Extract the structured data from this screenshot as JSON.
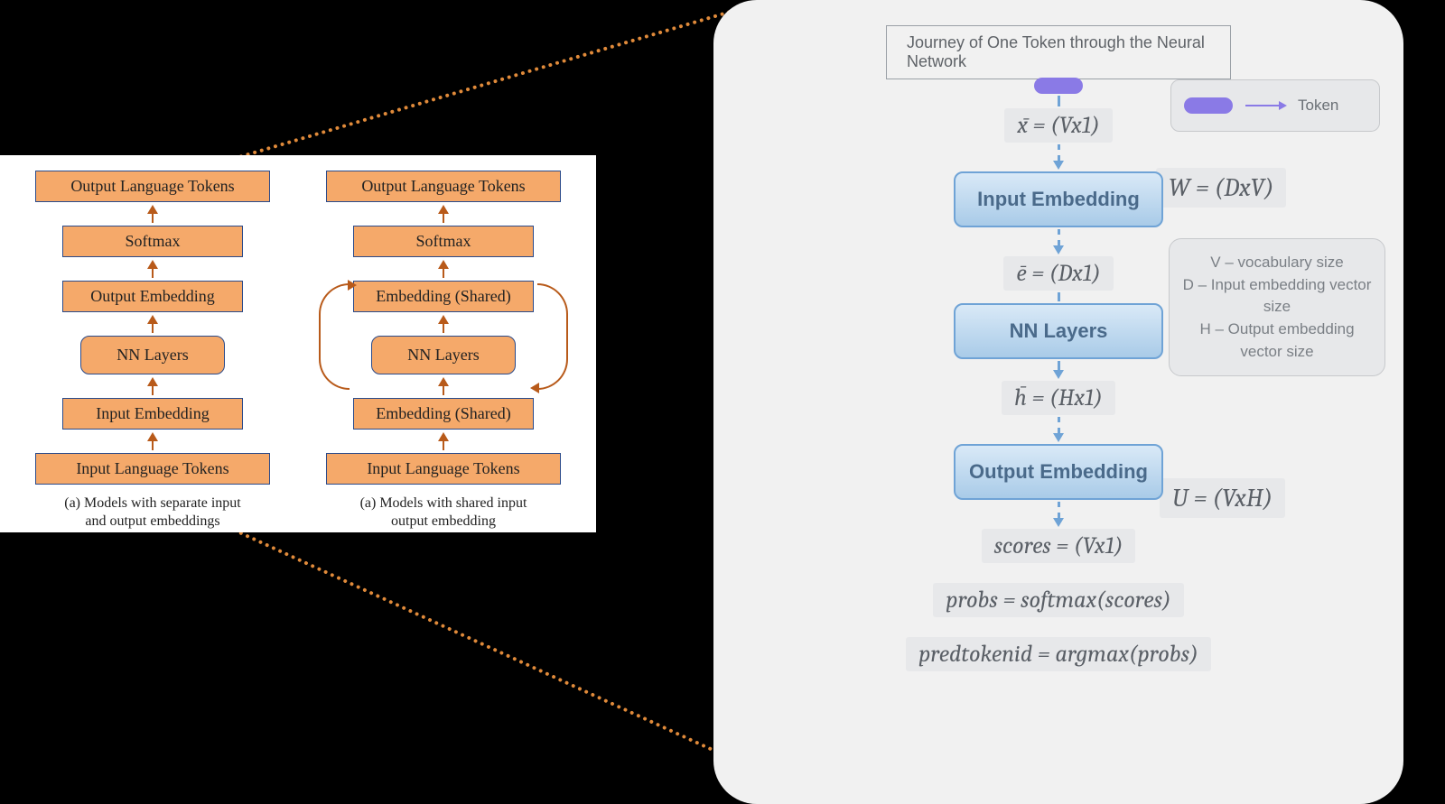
{
  "left_panel": {
    "col_a": {
      "boxes": [
        "Output Language Tokens",
        "Softmax",
        "Output Embedding",
        "NN Layers",
        "Input Embedding",
        "Input Language Tokens"
      ],
      "caption": "(a) Models with separate input\nand output embeddings"
    },
    "col_b": {
      "boxes": [
        "Output Language Tokens",
        "Softmax",
        "Embedding (Shared)",
        "NN Layers",
        "Embedding (Shared)",
        "Input Language Tokens"
      ],
      "caption": "(a) Models with shared input\noutput embedding"
    }
  },
  "right_panel": {
    "title": "Journey of One Token through the Neural Network",
    "legend_label": "Token",
    "flow": {
      "x": "x̄ = (Vx1)",
      "input": "Input Embedding",
      "e": "ē = (Dx1)",
      "nn": "NN Layers",
      "h": "h̄ = (Hx1)",
      "output": "Output Embedding",
      "scores": "scores  = (Vx1)",
      "probs": "probs = softmax(scores)",
      "pred": "predtokenid  = argmax(probs)"
    },
    "side": {
      "W": "W = (DxV)",
      "U": "U = (VxH)"
    },
    "dims": {
      "V": "V – vocabulary size",
      "D": "D –  Input embedding vector size",
      "H": "H – Output embedding vector size"
    }
  }
}
